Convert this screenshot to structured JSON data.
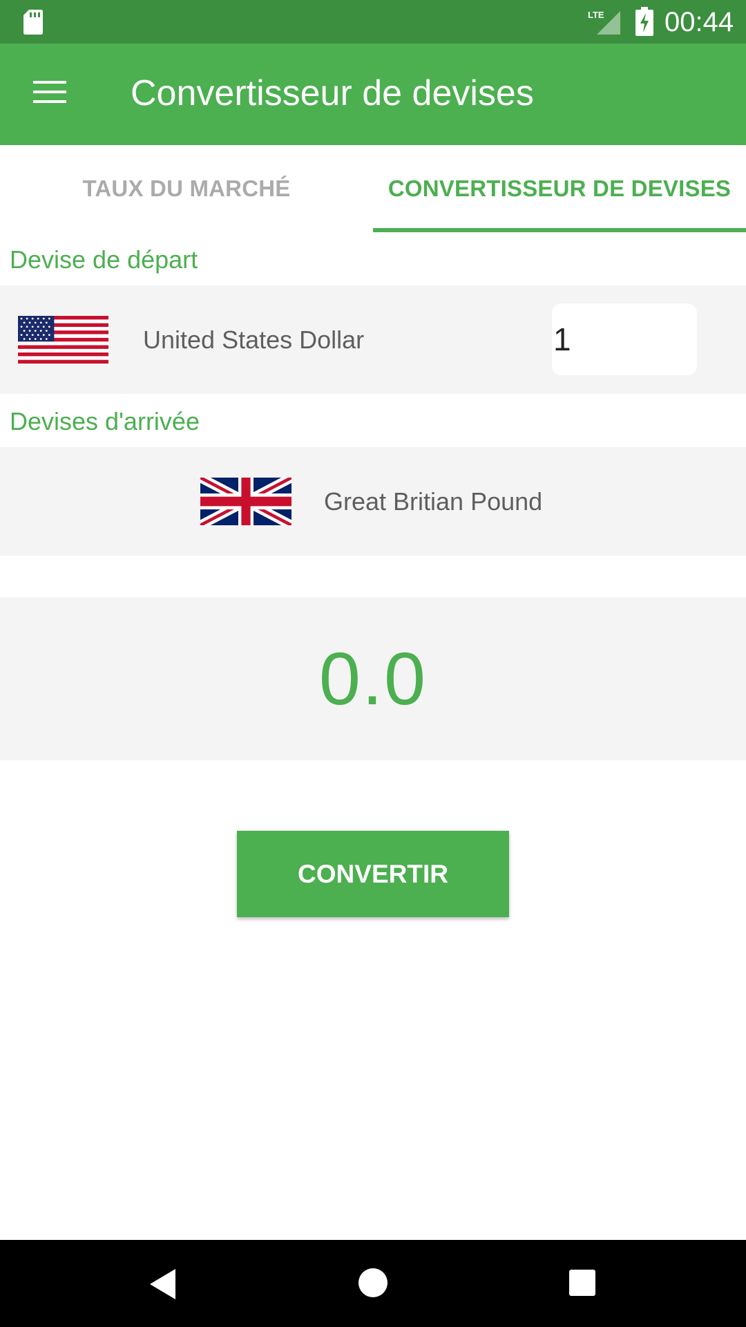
{
  "status_bar": {
    "time": "00:44",
    "icons": [
      "sd-card-icon",
      "lte-signal-icon",
      "battery-charging-icon"
    ]
  },
  "app_bar": {
    "title": "Convertisseur de devises",
    "menu_icon": "menu-icon"
  },
  "tabs": [
    {
      "label": "TAUX DU MARCHÉ",
      "active": false
    },
    {
      "label": "CONVERTISSEUR DE DEVISES",
      "active": true
    }
  ],
  "from_section": {
    "label": "Devise de départ",
    "currency_name": "United States Dollar",
    "flag_icon": "us-flag-icon",
    "amount": "1"
  },
  "to_section": {
    "label": "Devises d'arrivée",
    "currency_name": "Great Britian Pound",
    "flag_icon": "uk-flag-icon"
  },
  "result": {
    "value": "0.0"
  },
  "convert_button": {
    "label": "CONVERTIR"
  },
  "nav_bar": {
    "icons": [
      "back-icon",
      "home-icon",
      "recents-icon"
    ]
  },
  "colors": {
    "primary": "#4caf50",
    "status_bar": "#3c8f3f",
    "panel_background": "#f4f4f4",
    "inactive_tab": "#ababab",
    "secondary_text": "#5e5e5e"
  }
}
